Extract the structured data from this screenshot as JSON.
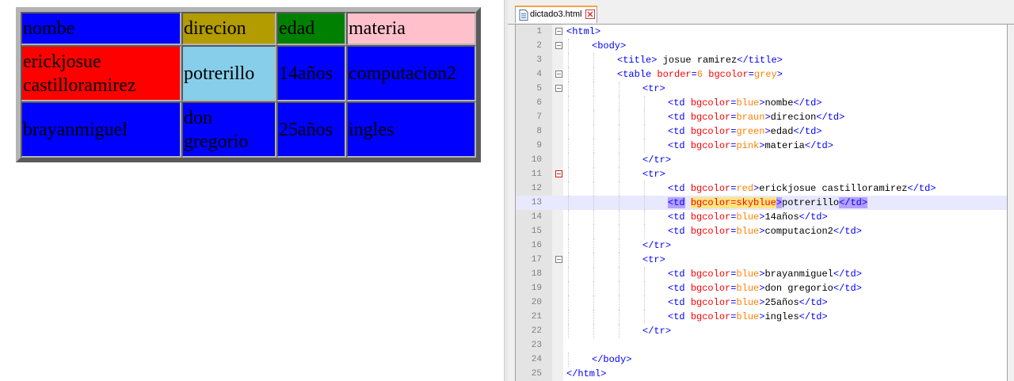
{
  "rendered_table": {
    "rows": [
      [
        {
          "text": "nombe",
          "bg": "#0000ff"
        },
        {
          "text": "direcion",
          "bg": "#b39c00"
        },
        {
          "text": "edad",
          "bg": "#008000"
        },
        {
          "text": "materia",
          "bg": "#ffc0cb"
        }
      ],
      [
        {
          "text": "erickjosue castilloramirez",
          "bg": "#ff0000"
        },
        {
          "text": "potrerillo",
          "bg": "#87ceeb"
        },
        {
          "text": "14años",
          "bg": "#0000ff"
        },
        {
          "text": "computacion2",
          "bg": "#0000ff"
        }
      ],
      [
        {
          "text": "brayanmiguel",
          "bg": "#0000ff"
        },
        {
          "text": "don gregorio",
          "bg": "#0000ff"
        },
        {
          "text": "25años",
          "bg": "#0000ff"
        },
        {
          "text": "ingles",
          "bg": "#0000ff"
        }
      ]
    ]
  },
  "editor": {
    "tab": {
      "label": "dictado3.html",
      "file_icon": "file-icon",
      "close_icon": "close-icon"
    },
    "current_line": 13,
    "lines": [
      {
        "n": "1",
        "indent": 0,
        "fold": "box",
        "seg": [
          [
            "ang",
            "<"
          ],
          [
            "tag",
            "html"
          ],
          [
            "ang",
            ">"
          ]
        ]
      },
      {
        "n": "2",
        "indent": 1,
        "fold": "box",
        "seg": [
          [
            "ang",
            "<"
          ],
          [
            "tag",
            "body"
          ],
          [
            "ang",
            ">"
          ]
        ]
      },
      {
        "n": "3",
        "indent": 2,
        "fold": "",
        "seg": [
          [
            "ang",
            "<"
          ],
          [
            "tag",
            "title"
          ],
          [
            "ang",
            "> "
          ],
          [
            "txt",
            "josue ramirez"
          ],
          [
            "ang",
            "</"
          ],
          [
            "tag",
            "title"
          ],
          [
            "ang",
            ">"
          ]
        ]
      },
      {
        "n": "4",
        "indent": 2,
        "fold": "box",
        "seg": [
          [
            "ang",
            "<"
          ],
          [
            "tag",
            "table "
          ],
          [
            "attr",
            "border"
          ],
          [
            "ang",
            "="
          ],
          [
            "val",
            "6"
          ],
          [
            "txt",
            " "
          ],
          [
            "attr",
            "bgcolor"
          ],
          [
            "ang",
            "="
          ],
          [
            "val",
            "grey"
          ],
          [
            "ang",
            ">"
          ]
        ]
      },
      {
        "n": "5",
        "indent": 3,
        "fold": "box",
        "seg": [
          [
            "ang",
            "<"
          ],
          [
            "tag",
            "tr"
          ],
          [
            "ang",
            ">"
          ]
        ]
      },
      {
        "n": "6",
        "indent": 4,
        "fold": "",
        "seg": [
          [
            "ang",
            "<"
          ],
          [
            "tag",
            "td "
          ],
          [
            "attr",
            "bgcolor"
          ],
          [
            "ang",
            "="
          ],
          [
            "val",
            "blue"
          ],
          [
            "ang",
            ">"
          ],
          [
            "txt",
            "nombe"
          ],
          [
            "ang",
            "</"
          ],
          [
            "tag",
            "td"
          ],
          [
            "ang",
            ">"
          ]
        ]
      },
      {
        "n": "7",
        "indent": 4,
        "fold": "",
        "seg": [
          [
            "ang",
            "<"
          ],
          [
            "tag",
            "td "
          ],
          [
            "attr",
            "bgcolor"
          ],
          [
            "ang",
            "="
          ],
          [
            "val",
            "braun"
          ],
          [
            "ang",
            ">"
          ],
          [
            "txt",
            "direcion"
          ],
          [
            "ang",
            "</"
          ],
          [
            "tag",
            "td"
          ],
          [
            "ang",
            ">"
          ]
        ]
      },
      {
        "n": "8",
        "indent": 4,
        "fold": "",
        "seg": [
          [
            "ang",
            "<"
          ],
          [
            "tag",
            "td "
          ],
          [
            "attr",
            "bgcolor"
          ],
          [
            "ang",
            "="
          ],
          [
            "val",
            "green"
          ],
          [
            "ang",
            ">"
          ],
          [
            "txt",
            "edad"
          ],
          [
            "ang",
            "</"
          ],
          [
            "tag",
            "td"
          ],
          [
            "ang",
            ">"
          ]
        ]
      },
      {
        "n": "9",
        "indent": 4,
        "fold": "",
        "seg": [
          [
            "ang",
            "<"
          ],
          [
            "tag",
            "td "
          ],
          [
            "attr",
            "bgcolor"
          ],
          [
            "ang",
            "="
          ],
          [
            "val",
            "pink"
          ],
          [
            "ang",
            ">"
          ],
          [
            "txt",
            "materia"
          ],
          [
            "ang",
            "</"
          ],
          [
            "tag",
            "td"
          ],
          [
            "ang",
            ">"
          ]
        ]
      },
      {
        "n": "10",
        "indent": 3,
        "fold": "",
        "seg": [
          [
            "ang",
            "</"
          ],
          [
            "tag",
            "tr"
          ],
          [
            "ang",
            ">"
          ]
        ]
      },
      {
        "n": "11",
        "indent": 3,
        "fold": "redbox",
        "seg": [
          [
            "ang",
            "<"
          ],
          [
            "tag",
            "tr"
          ],
          [
            "ang",
            ">"
          ]
        ]
      },
      {
        "n": "12",
        "indent": 4,
        "fold": "",
        "seg": [
          [
            "ang",
            "<"
          ],
          [
            "tag",
            "td "
          ],
          [
            "attr",
            "bgcolor"
          ],
          [
            "ang",
            "="
          ],
          [
            "val",
            "red"
          ],
          [
            "ang",
            ">"
          ],
          [
            "txt",
            "erickjosue castilloramirez"
          ],
          [
            "ang",
            "</"
          ],
          [
            "tag",
            "td"
          ],
          [
            "ang",
            ">"
          ]
        ]
      },
      {
        "n": "13",
        "indent": 4,
        "fold": "",
        "seg": [
          [
            "hltag",
            "<td"
          ],
          [
            "txt",
            " "
          ],
          [
            "hlattr",
            "bgcolor=skyblue"
          ],
          [
            "hltag",
            ">"
          ],
          [
            "txt",
            "potrerillo"
          ],
          [
            "hltag",
            "</td>"
          ]
        ]
      },
      {
        "n": "14",
        "indent": 4,
        "fold": "",
        "seg": [
          [
            "ang",
            "<"
          ],
          [
            "tag",
            "td "
          ],
          [
            "attr",
            "bgcolor"
          ],
          [
            "ang",
            "="
          ],
          [
            "val",
            "blue"
          ],
          [
            "ang",
            ">"
          ],
          [
            "txt",
            "14años"
          ],
          [
            "ang",
            "</"
          ],
          [
            "tag",
            "td"
          ],
          [
            "ang",
            ">"
          ]
        ]
      },
      {
        "n": "15",
        "indent": 4,
        "fold": "",
        "seg": [
          [
            "ang",
            "<"
          ],
          [
            "tag",
            "td "
          ],
          [
            "attr",
            "bgcolor"
          ],
          [
            "ang",
            "="
          ],
          [
            "val",
            "blue"
          ],
          [
            "ang",
            ">"
          ],
          [
            "txt",
            "computacion2"
          ],
          [
            "ang",
            "</"
          ],
          [
            "tag",
            "td"
          ],
          [
            "ang",
            ">"
          ]
        ]
      },
      {
        "n": "16",
        "indent": 3,
        "fold": "",
        "seg": [
          [
            "ang",
            "</"
          ],
          [
            "tag",
            "tr"
          ],
          [
            "ang",
            ">"
          ]
        ]
      },
      {
        "n": "17",
        "indent": 3,
        "fold": "box",
        "seg": [
          [
            "ang",
            "<"
          ],
          [
            "tag",
            "tr"
          ],
          [
            "ang",
            ">"
          ]
        ]
      },
      {
        "n": "18",
        "indent": 4,
        "fold": "",
        "seg": [
          [
            "ang",
            "<"
          ],
          [
            "tag",
            "td "
          ],
          [
            "attr",
            "bgcolor"
          ],
          [
            "ang",
            "="
          ],
          [
            "val",
            "blue"
          ],
          [
            "ang",
            ">"
          ],
          [
            "txt",
            "brayanmiguel"
          ],
          [
            "ang",
            "</"
          ],
          [
            "tag",
            "td"
          ],
          [
            "ang",
            ">"
          ]
        ]
      },
      {
        "n": "19",
        "indent": 4,
        "fold": "",
        "seg": [
          [
            "ang",
            "<"
          ],
          [
            "tag",
            "td "
          ],
          [
            "attr",
            "bgcolor"
          ],
          [
            "ang",
            "="
          ],
          [
            "val",
            "blue"
          ],
          [
            "ang",
            ">"
          ],
          [
            "txt",
            "don gregorio"
          ],
          [
            "ang",
            "</"
          ],
          [
            "tag",
            "td"
          ],
          [
            "ang",
            ">"
          ]
        ]
      },
      {
        "n": "20",
        "indent": 4,
        "fold": "",
        "seg": [
          [
            "ang",
            "<"
          ],
          [
            "tag",
            "td "
          ],
          [
            "attr",
            "bgcolor"
          ],
          [
            "ang",
            "="
          ],
          [
            "val",
            "blue"
          ],
          [
            "ang",
            ">"
          ],
          [
            "txt",
            "25años"
          ],
          [
            "ang",
            "</"
          ],
          [
            "tag",
            "td"
          ],
          [
            "ang",
            ">"
          ]
        ]
      },
      {
        "n": "21",
        "indent": 4,
        "fold": "",
        "seg": [
          [
            "ang",
            "<"
          ],
          [
            "tag",
            "td "
          ],
          [
            "attr",
            "bgcolor"
          ],
          [
            "ang",
            "="
          ],
          [
            "val",
            "blue"
          ],
          [
            "ang",
            ">"
          ],
          [
            "txt",
            "ingles"
          ],
          [
            "ang",
            "</"
          ],
          [
            "tag",
            "td"
          ],
          [
            "ang",
            ">"
          ]
        ]
      },
      {
        "n": "22",
        "indent": 3,
        "fold": "",
        "seg": [
          [
            "ang",
            "</"
          ],
          [
            "tag",
            "tr"
          ],
          [
            "ang",
            ">"
          ]
        ]
      },
      {
        "n": "23",
        "indent": 0,
        "fold": "",
        "seg": []
      },
      {
        "n": "24",
        "indent": 1,
        "fold": "",
        "seg": [
          [
            "ang",
            "</"
          ],
          [
            "tag",
            "body"
          ],
          [
            "ang",
            ">"
          ]
        ]
      },
      {
        "n": "25",
        "indent": 0,
        "fold": "",
        "seg": [
          [
            "ang",
            "</"
          ],
          [
            "tag",
            "html"
          ],
          [
            "ang",
            ">"
          ]
        ]
      }
    ]
  }
}
